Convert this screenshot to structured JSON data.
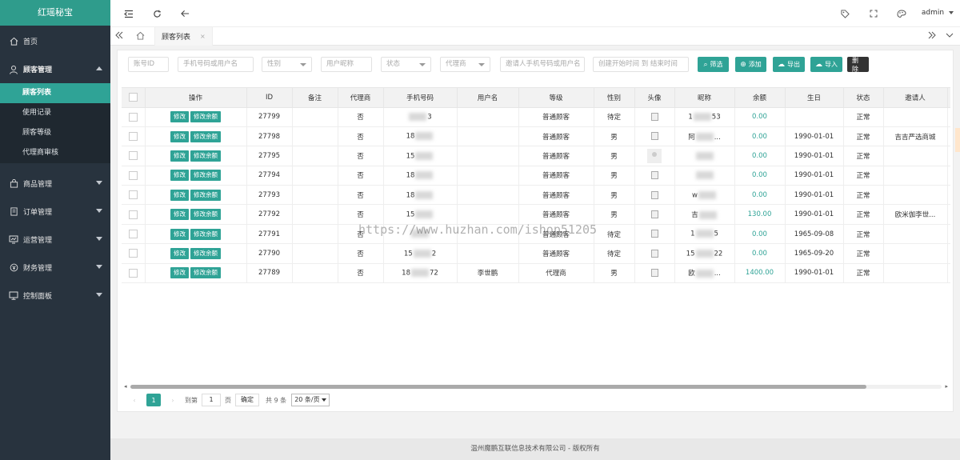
{
  "sidebar": {
    "logo": "红瑶秘宝",
    "items": [
      {
        "label": "首页"
      },
      {
        "label": "顾客管理"
      },
      {
        "label": "商品管理"
      },
      {
        "label": "订单管理"
      },
      {
        "label": "运营管理"
      },
      {
        "label": "财务管理"
      },
      {
        "label": "控制面板"
      }
    ],
    "sub_items": [
      "顾客列表",
      "使用记录",
      "顾客等级",
      "代理商审核"
    ]
  },
  "topbar": {
    "user": "admin"
  },
  "tabbar": {
    "tab_label": "顾客列表",
    "close": "×"
  },
  "filters": {
    "id_placeholder": "账号ID",
    "phone_placeholder": "手机号码或用户名",
    "gender_placeholder": "性别",
    "nickname_placeholder": "用户昵称",
    "status_placeholder": "状态",
    "agent_placeholder": "代理商",
    "inviter_placeholder": "邀请人手机号码或用户名",
    "time_placeholder": "创建开始时间 到 结束时间"
  },
  "buttons": {
    "filter": "筛选",
    "add": "添加",
    "export": "导出",
    "import": "导入",
    "delete": "删除"
  },
  "table": {
    "headers": [
      "操作",
      "ID",
      "备注",
      "代理商",
      "手机号码",
      "用户名",
      "等级",
      "性别",
      "头像",
      "昵称",
      "余额",
      "生日",
      "状态",
      "邀请人"
    ],
    "edit_label": "修改",
    "edit_balance_label": "修改余额",
    "rows": [
      {
        "id": "27799",
        "remark": "",
        "agent": "否",
        "phone_a": "",
        "phone_b": "3",
        "username": "",
        "level": "普通顾客",
        "gender": "待定",
        "nick_a": "1",
        "nick_b": "53",
        "balance": "0.00",
        "birthday": "",
        "status": "正常",
        "inviter": ""
      },
      {
        "id": "27798",
        "remark": "",
        "agent": "否",
        "phone_a": "18",
        "phone_b": "",
        "username": "",
        "level": "普通顾客",
        "gender": "男",
        "nick_a": "阿",
        "nick_b": "...",
        "balance": "0.00",
        "birthday": "1990-01-01",
        "status": "正常",
        "inviter": "吉吉严选商城"
      },
      {
        "id": "27795",
        "remark": "",
        "agent": "否",
        "phone_a": "15",
        "phone_b": "",
        "username": "",
        "level": "普通顾客",
        "gender": "男",
        "nick_a": "",
        "nick_b": "",
        "balance": "0.00",
        "birthday": "1990-01-01",
        "status": "正常",
        "inviter": ""
      },
      {
        "id": "27794",
        "remark": "",
        "agent": "否",
        "phone_a": "18",
        "phone_b": "",
        "username": "",
        "level": "普通顾客",
        "gender": "男",
        "nick_a": "",
        "nick_b": "",
        "balance": "0.00",
        "birthday": "1990-01-01",
        "status": "正常",
        "inviter": ""
      },
      {
        "id": "27793",
        "remark": "",
        "agent": "否",
        "phone_a": "18",
        "phone_b": "",
        "username": "",
        "level": "普通顾客",
        "gender": "男",
        "nick_a": "w",
        "nick_b": "",
        "balance": "0.00",
        "birthday": "1990-01-01",
        "status": "正常",
        "inviter": ""
      },
      {
        "id": "27792",
        "remark": "",
        "agent": "否",
        "phone_a": "15",
        "phone_b": "",
        "username": "",
        "level": "普通顾客",
        "gender": "男",
        "nick_a": "吉",
        "nick_b": "",
        "balance": "130.00",
        "birthday": "1990-01-01",
        "status": "正常",
        "inviter": "欧米伽李世..."
      },
      {
        "id": "27791",
        "remark": "",
        "agent": "否",
        "phone_a": "",
        "phone_b": "",
        "username": "",
        "level": "普通顾客",
        "gender": "待定",
        "nick_a": "1",
        "nick_b": "5",
        "balance": "0.00",
        "birthday": "1965-09-08",
        "status": "正常",
        "inviter": ""
      },
      {
        "id": "27790",
        "remark": "",
        "agent": "否",
        "phone_a": "15",
        "phone_b": "2",
        "username": "",
        "level": "普通顾客",
        "gender": "待定",
        "nick_a": "15",
        "nick_b": "22",
        "balance": "0.00",
        "birthday": "1965-09-20",
        "status": "正常",
        "inviter": ""
      },
      {
        "id": "27789",
        "remark": "",
        "agent": "否",
        "phone_a": "18",
        "phone_b": "72",
        "username": "李世鹏",
        "level": "代理商",
        "gender": "男",
        "nick_a": "欧",
        "nick_b": "...",
        "balance": "1400.00",
        "birthday": "1990-01-01",
        "status": "正常",
        "inviter": ""
      }
    ]
  },
  "watermark": "https://www.huzhan.com/ishop51205",
  "pager": {
    "current": "1",
    "goto_label": "到第",
    "goto_value": "1",
    "page_unit": "页",
    "confirm": "确定",
    "total": "共 9 条",
    "per_page": "20 条/页"
  },
  "footer": "温州魔鹏互联信息技术有限公司 - 版权所有",
  "colors": {
    "accent": "#2fa396",
    "sidebar": "#28333e",
    "logo": "#2f9c8c"
  }
}
